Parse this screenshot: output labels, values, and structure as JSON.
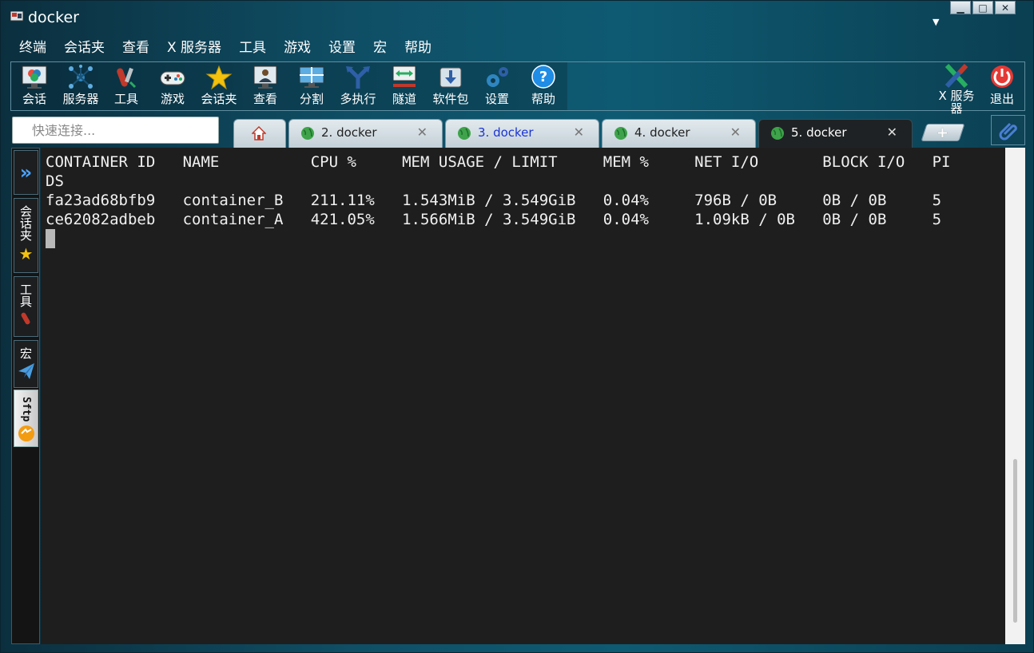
{
  "window": {
    "title": "docker"
  },
  "menu": [
    "终端",
    "会话夹",
    "查看",
    "X 服务器",
    "工具",
    "游戏",
    "设置",
    "宏",
    "帮助"
  ],
  "toolbar": {
    "items": [
      "会话",
      "服务器",
      "工具",
      "游戏",
      "会话夹",
      "查看",
      "分割",
      "多执行",
      "隧道",
      "软件包",
      "设置",
      "帮助"
    ],
    "xserver_label": "X 服务器",
    "exit_label": "退出"
  },
  "quick_connect": {
    "placeholder": "快速连接..."
  },
  "tabs": [
    {
      "label": "2. docker"
    },
    {
      "label": "3. docker"
    },
    {
      "label": "4. docker"
    },
    {
      "label": "5. docker"
    }
  ],
  "left_panel": {
    "sessions": "会话夹",
    "tools": "工具",
    "macros": "宏",
    "sftp": "Sftp"
  },
  "terminal": {
    "lines": [
      "CONTAINER ID   NAME          CPU %     MEM USAGE / LIMIT     MEM %     NET I/O       BLOCK I/O   PI",
      "DS",
      "fa23ad68bfb9   container_B   211.11%   1.543MiB / 3.549GiB   0.04%     796B / 0B     0B / 0B     5",
      "ce62082adbeb   container_A   421.05%   1.566MiB / 3.549GiB   0.04%     1.09kB / 0B   0B / 0B     5"
    ]
  }
}
